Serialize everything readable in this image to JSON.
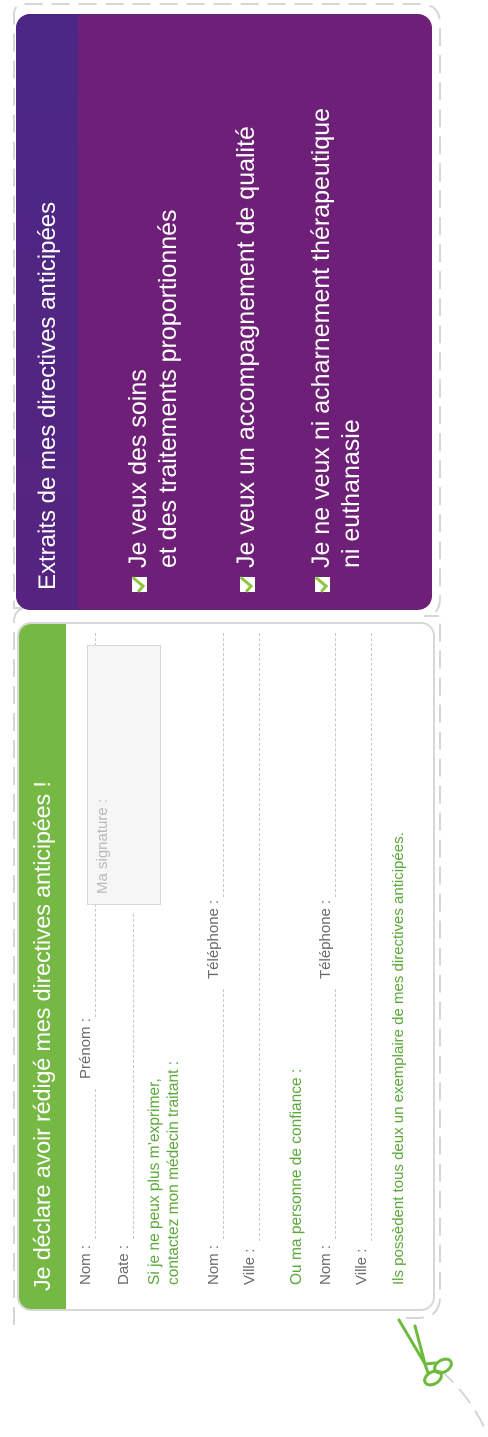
{
  "purple_card": {
    "title": "Extraits de mes directives anticipées",
    "statements": [
      {
        "line1": "Je veux des soins",
        "line2": "et des traitements proportionnés"
      },
      {
        "line1": "Je veux un accompagnement de qualité",
        "line2": ""
      },
      {
        "line1": "Je ne veux ni acharnement thérapeutique",
        "line2": "ni euthanasie"
      }
    ]
  },
  "green_card": {
    "title": "Je déclare avoir rédigé mes directives anticipées !",
    "nom": "Nom :",
    "prenom": "Prénom :",
    "date": "Date :",
    "signature": "Ma signature :",
    "medecin_line1": "Si je ne peux plus m’exprimer,",
    "medecin_line2": "contactez mon médecin traitant :",
    "telephone": "Téléphone :",
    "ville": "Ville :",
    "confiance": "Ou ma personne de confiance :",
    "footer": "Ils possèdent tous deux un exemplaire de mes directives anticipées."
  },
  "colors": {
    "purple": "#6e1f77",
    "purple_dark": "#4b2785",
    "green": "#75b843",
    "green_text": "#5aa83a"
  },
  "icons": [
    "checkbox-checked-icon",
    "scissors-icon"
  ]
}
